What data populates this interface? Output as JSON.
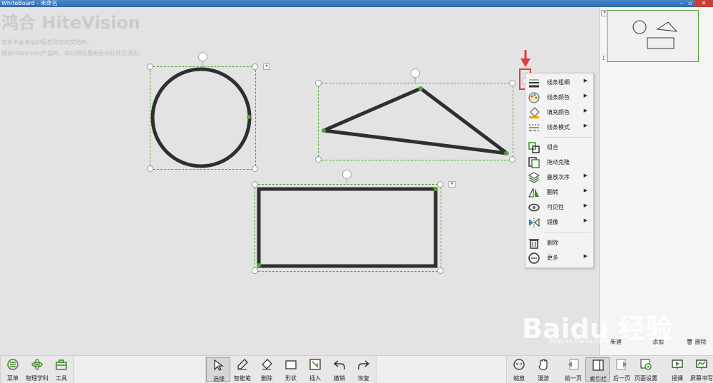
{
  "window": {
    "title": "WhiteBoard - 未命名"
  },
  "canvas": {
    "logo": "鸿合 HiteVision",
    "notice": [
      "软件不会将水印保存到您的文档中。",
      "链接HiteVision产品时，水印将在重新启动软件后消失。"
    ]
  },
  "context_menu": {
    "items": [
      {
        "label": "线条粗细",
        "icon": "line-width-icon",
        "submenu": true
      },
      {
        "label": "线条颜色",
        "icon": "palette-icon",
        "submenu": true
      },
      {
        "label": "填充颜色",
        "icon": "paint-bucket-icon",
        "submenu": true
      },
      {
        "label": "线条模式",
        "icon": "line-style-icon",
        "submenu": true
      },
      {
        "label": "组合",
        "icon": "group-icon",
        "submenu": false
      },
      {
        "label": "拖动克隆",
        "icon": "drag-clone-icon",
        "submenu": false
      },
      {
        "label": "叠放次序",
        "icon": "layers-icon",
        "submenu": true
      },
      {
        "label": "翻转",
        "icon": "flip-icon",
        "submenu": true
      },
      {
        "label": "可见性",
        "icon": "eye-icon",
        "submenu": true
      },
      {
        "label": "镜像",
        "icon": "mirror-icon",
        "submenu": true
      },
      {
        "label": "删除",
        "icon": "trash-icon",
        "submenu": false
      },
      {
        "label": "更多",
        "icon": "more-icon",
        "submenu": true
      }
    ]
  },
  "side_panel": {
    "page_number": "1",
    "new_label": "新建",
    "add_label": "添加",
    "delete_label": "删除"
  },
  "toolbar": {
    "left": [
      "菜单",
      "物理学科",
      "工具"
    ],
    "center": [
      "选择",
      "智能笔",
      "删除",
      "形状",
      "插入",
      "撤销",
      "恢复"
    ],
    "right": [
      "缩放",
      "漫游",
      "前一页",
      "索引栏",
      "后一页",
      "页面设置",
      "授课",
      "屏幕书写"
    ]
  },
  "watermark": {
    "brand": "Baidu 经验",
    "url": "jingyan.baidu.com"
  },
  "colors": {
    "accent": "#4ea82e",
    "highlight": "#e23b3b",
    "shape_stroke": "#2f2f2f"
  }
}
